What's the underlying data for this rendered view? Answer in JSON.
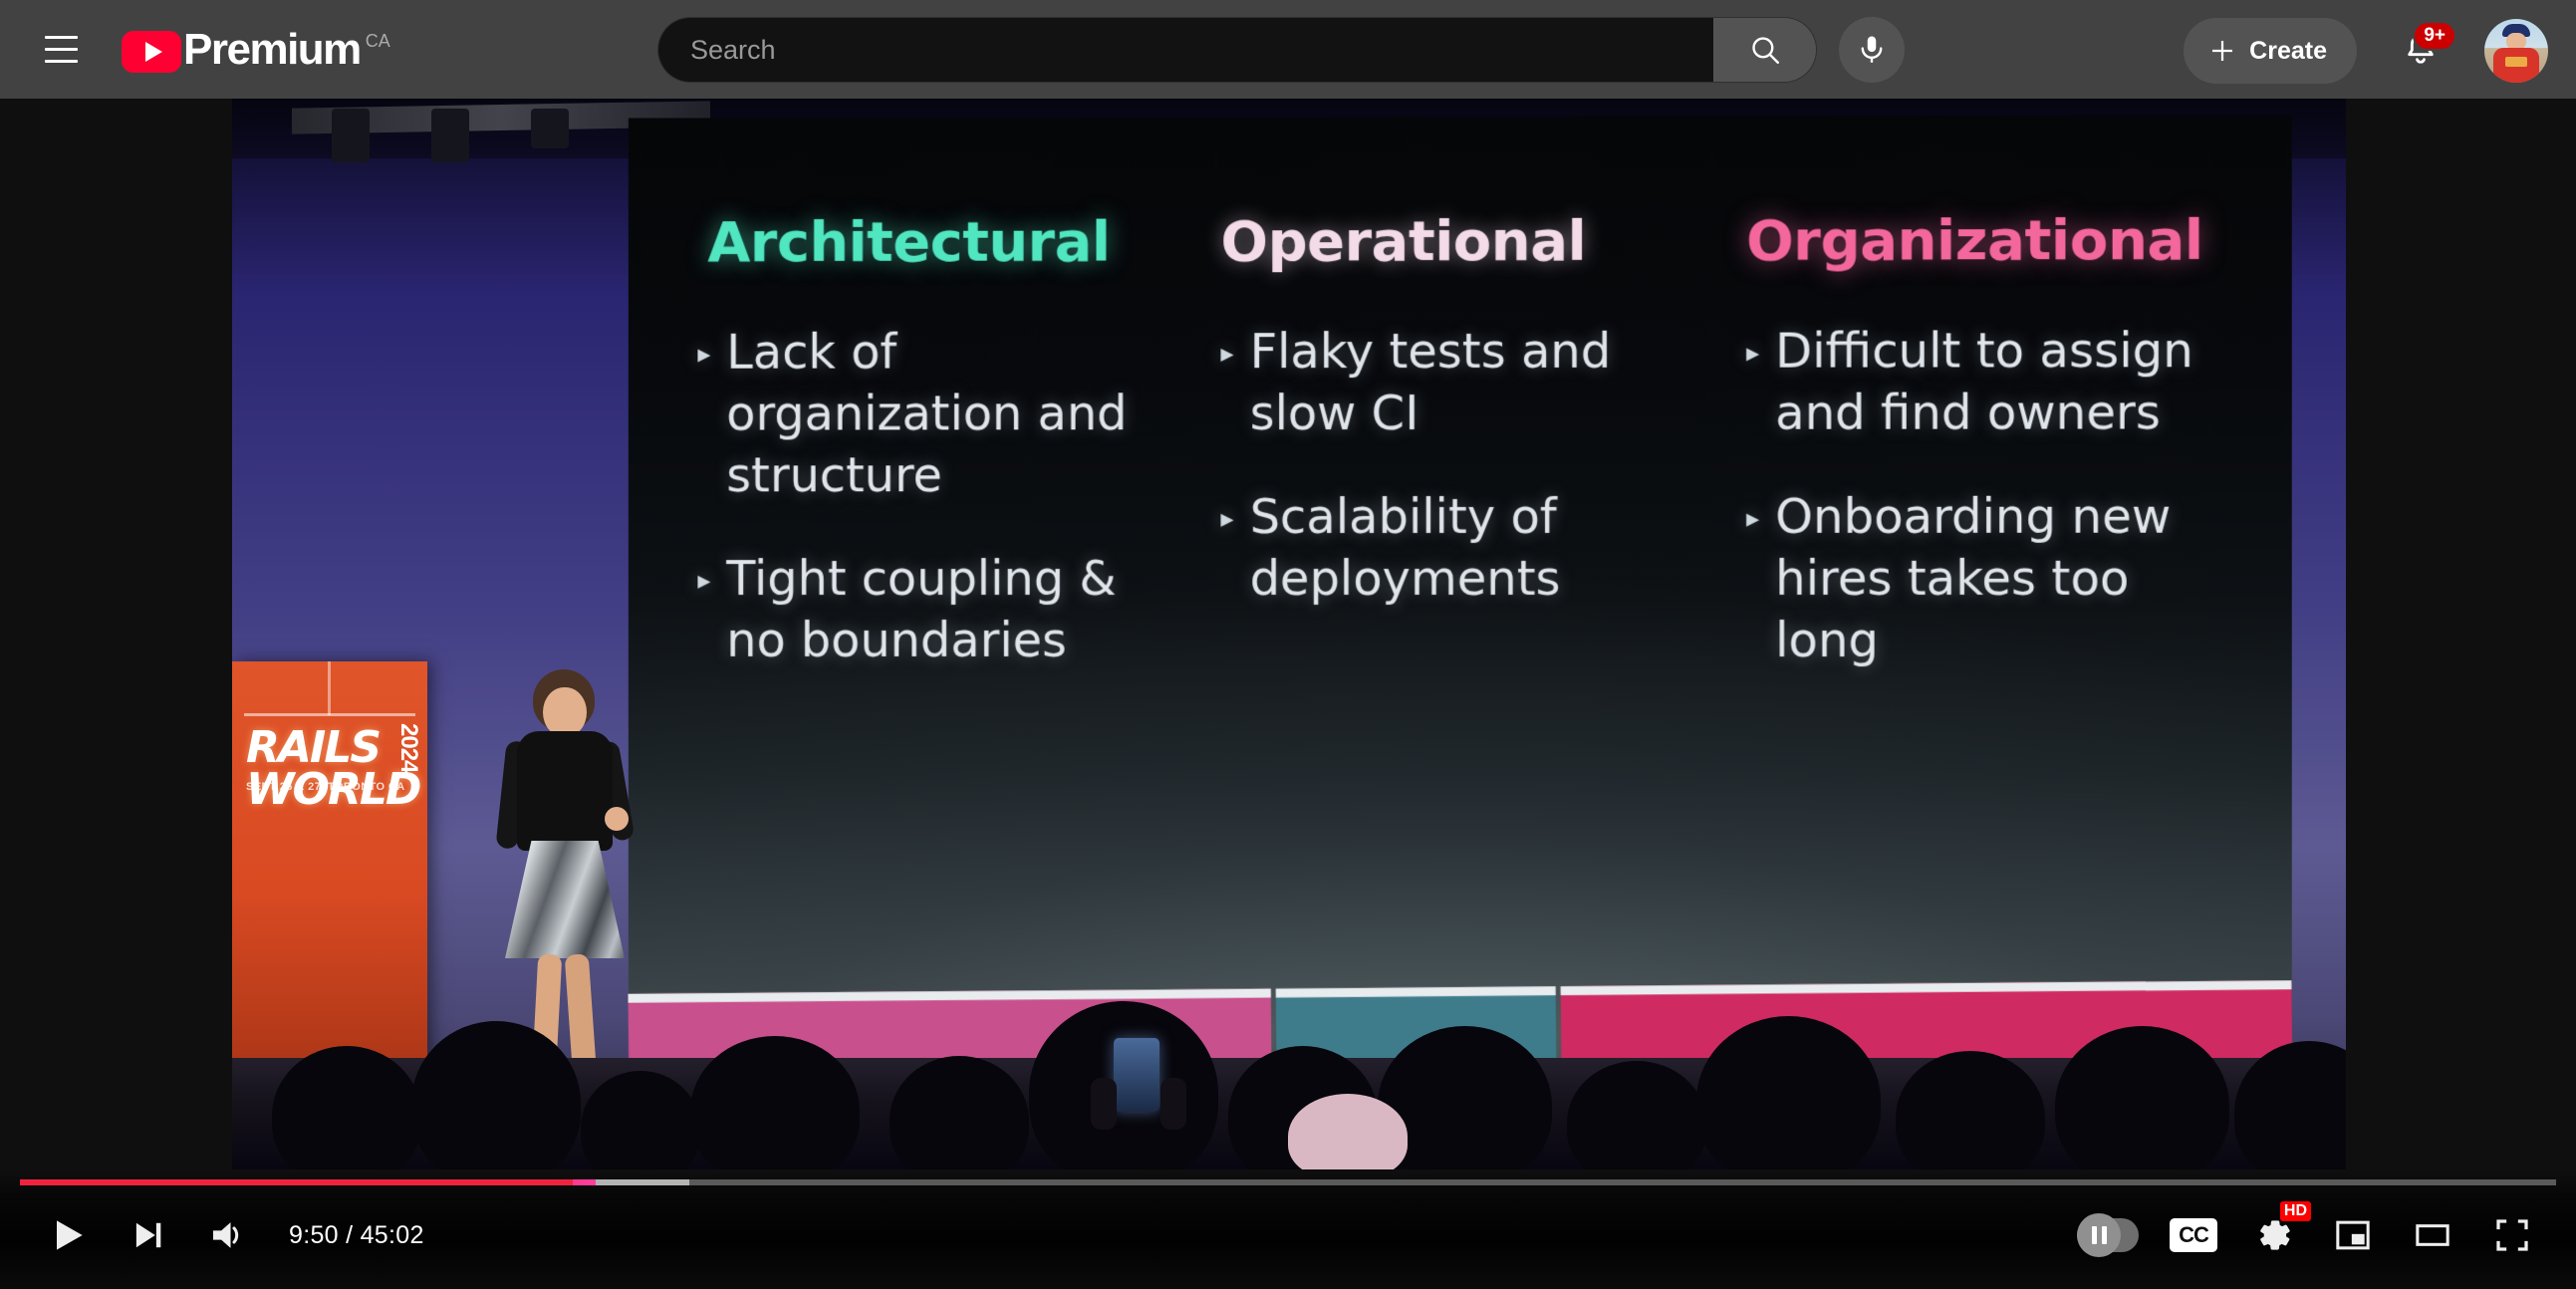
{
  "header": {
    "menu_icon": "hamburger-icon",
    "brand": {
      "word": "Premium",
      "country": "CA",
      "logo_icon": "youtube-play-logo"
    },
    "search": {
      "placeholder": "Search",
      "value": "",
      "search_icon": "magnifier-icon",
      "mic_icon": "microphone-icon"
    },
    "create": {
      "label": "Create",
      "icon": "plus-icon"
    },
    "notifications": {
      "icon": "bell-icon",
      "badge": "9+"
    },
    "avatar": {
      "name": "account-avatar"
    }
  },
  "player": {
    "current_time": "9:50",
    "separator": "/",
    "duration": "45:02",
    "time_display": "9:50 / 45:02",
    "progress_played_pct": 21.8,
    "progress_buffered_pct": 26.4,
    "controls": {
      "play": "play-button",
      "next": "next-video-button",
      "volume": "volume-icon",
      "autoplay": "autoplay-toggle",
      "subtitles": "CC",
      "settings": "settings-gear",
      "quality_badge": "HD",
      "miniplayer": "miniplayer-button",
      "theater": "theater-mode-button",
      "fullscreen": "fullscreen-button"
    },
    "colors": {
      "progress_played": "#f0233f",
      "progress_buffered": "#b4b4b4",
      "progress_track": "#5a5a5a",
      "hd_badge": "#ff0000",
      "notification_badge": "#cc0000"
    }
  },
  "slide": {
    "columns": [
      {
        "title": "Architectural",
        "title_color": "#4fe6c0",
        "bullets": [
          "Lack of organization and structure",
          "Tight coupling & no boundaries"
        ]
      },
      {
        "title": "Operational",
        "title_color": "#f3dbe8",
        "bullets": [
          "Flaky tests and slow CI",
          "Scalability of deployments"
        ]
      },
      {
        "title": "Organizational",
        "title_color": "#f3679c",
        "bullets": [
          "Difficult to assign and find owners",
          "Onboarding new hires takes too long"
        ]
      }
    ],
    "bullet_marker": "▸",
    "accent_bars": [
      {
        "name": "bar-pink",
        "color": "#c8508d"
      },
      {
        "name": "bar-teal",
        "color": "#3e7c8c"
      },
      {
        "name": "bar-crimson",
        "color": "#cf2a61"
      }
    ]
  },
  "stage": {
    "podium": {
      "line1": "RAILS",
      "line2": "WORLD",
      "year": "2024",
      "subtitle": "SEPT 26 & 27, TORONTO CA"
    }
  }
}
